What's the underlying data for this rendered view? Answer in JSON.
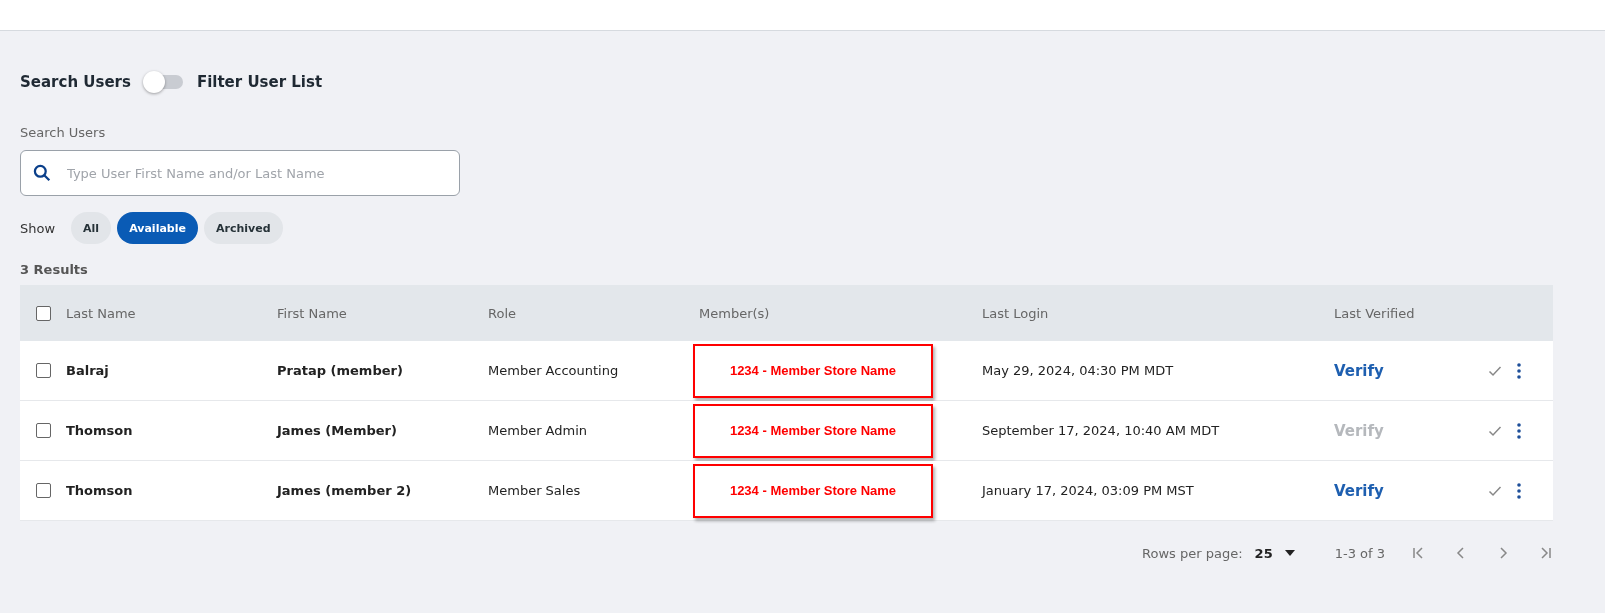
{
  "mode_toggle": {
    "left_label": "Search Users",
    "right_label": "Filter User List",
    "on": false
  },
  "search": {
    "label": "Search Users",
    "placeholder": "Type User First Name and/or Last Name"
  },
  "filter": {
    "label": "Show",
    "chips": [
      {
        "label": "All",
        "selected": false
      },
      {
        "label": "Available",
        "selected": true
      },
      {
        "label": "Archived",
        "selected": false
      }
    ]
  },
  "results_count": "3 Results",
  "table": {
    "select_all_checked": false,
    "columns": [
      "Last Name",
      "First Name",
      "Role",
      "Member(s)",
      "Last Login",
      "Last Verified"
    ],
    "rows": [
      {
        "checked": false,
        "last_name": "Balraj",
        "first_name": "Pratap (member)",
        "role": "Member Accounting",
        "members": "1234 - Member Store Name",
        "last_login": "May 29, 2024, 04:30 PM MDT",
        "verify": "Verify",
        "verify_disabled": false
      },
      {
        "checked": false,
        "last_name": "Thomson",
        "first_name": "James (Member)",
        "role": "Member Admin",
        "members": "1234 - Member Store Name",
        "last_login": "September 17, 2024, 10:40 AM MDT",
        "verify": "Verify",
        "verify_disabled": true
      },
      {
        "checked": false,
        "last_name": "Thomson",
        "first_name": "James (member 2)",
        "role": "Member Sales",
        "members": "1234 - Member Store Name",
        "last_login": "January 17, 2024, 03:09 PM MST",
        "verify": "Verify",
        "verify_disabled": false
      }
    ]
  },
  "pagination": {
    "rows_per_page_label": "Rows per page:",
    "rows_per_page": "25",
    "range": "1-3 of 3"
  }
}
